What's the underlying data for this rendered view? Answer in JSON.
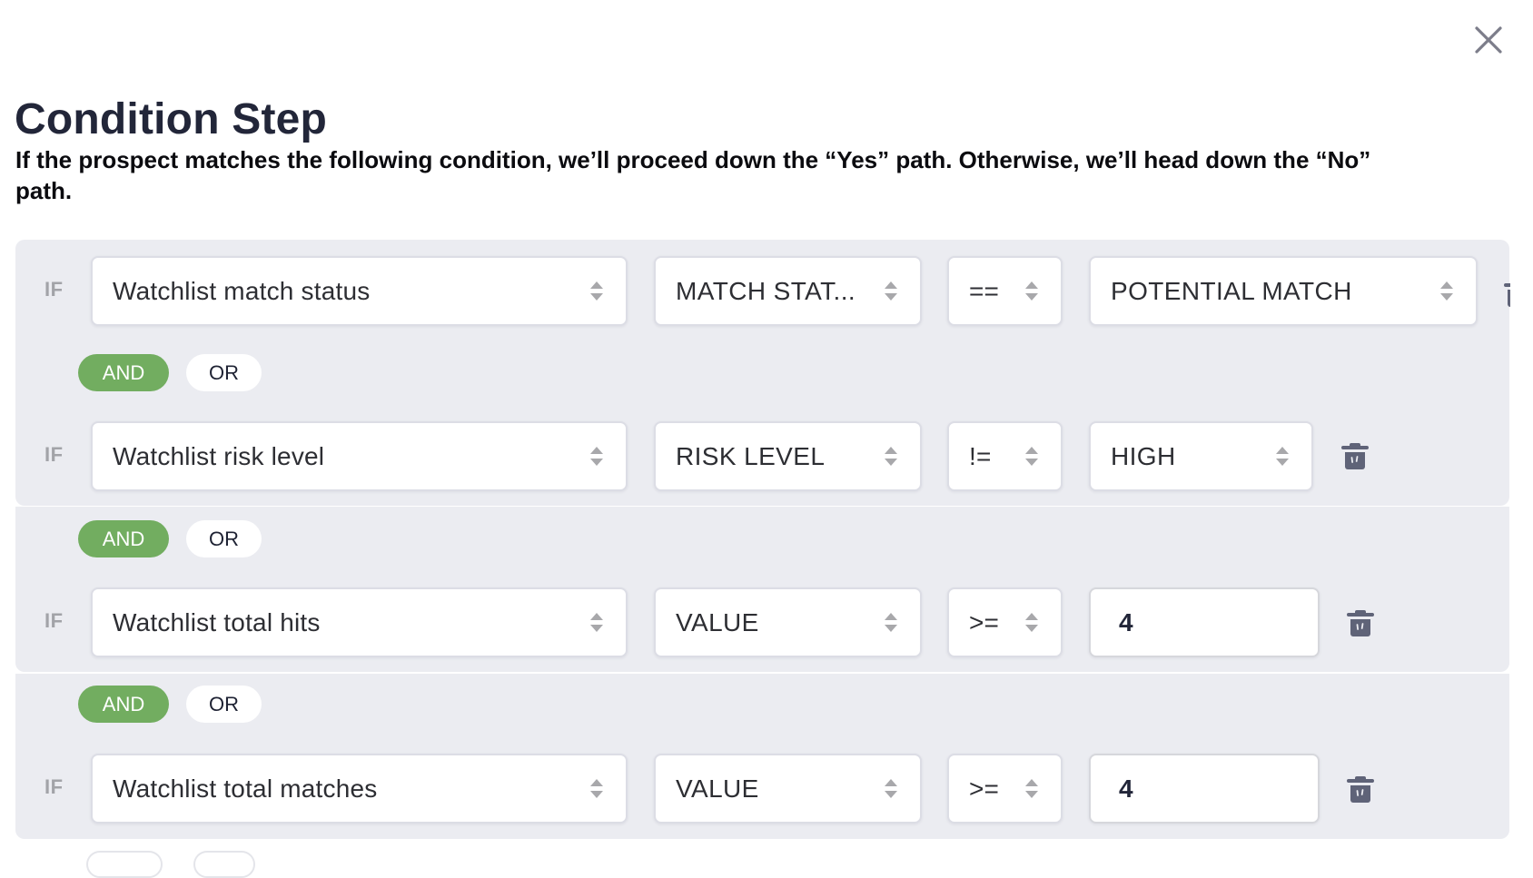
{
  "dialog": {
    "title": "Condition Step",
    "description": "If the prospect matches the following condition, we’ll proceed down the “Yes” path. Otherwise, we’ll head down the “No” path.",
    "close_icon": "close-x-icon"
  },
  "colors": {
    "panel_bg": "#ebecf1",
    "and_active": "#72ad60",
    "title": "#222639",
    "trash_icon": "#5f6378"
  },
  "if_label": "IF",
  "conditions": [
    {
      "field": "Watchlist match status",
      "property": "MATCH STAT...",
      "operator": "==",
      "value": "POTENTIAL MATCH",
      "value_type": "select",
      "delete_icon": "trash-icon"
    },
    {
      "field": "Watchlist risk level",
      "property": "RISK LEVEL",
      "operator": "!=",
      "value": "HIGH",
      "value_type": "select",
      "delete_icon": "trash-icon"
    },
    {
      "field": "Watchlist total hits",
      "property": "VALUE",
      "operator": ">=",
      "value": "4",
      "value_type": "input",
      "delete_icon": "trash-icon"
    },
    {
      "field": "Watchlist total matches",
      "property": "VALUE",
      "operator": ">=",
      "value": "4",
      "value_type": "input",
      "delete_icon": "trash-icon"
    }
  ],
  "connectors": [
    {
      "and_label": "AND",
      "or_label": "OR",
      "selected": "AND"
    },
    {
      "and_label": "AND",
      "or_label": "OR",
      "selected": "AND"
    },
    {
      "and_label": "AND",
      "or_label": "OR",
      "selected": "AND"
    }
  ]
}
